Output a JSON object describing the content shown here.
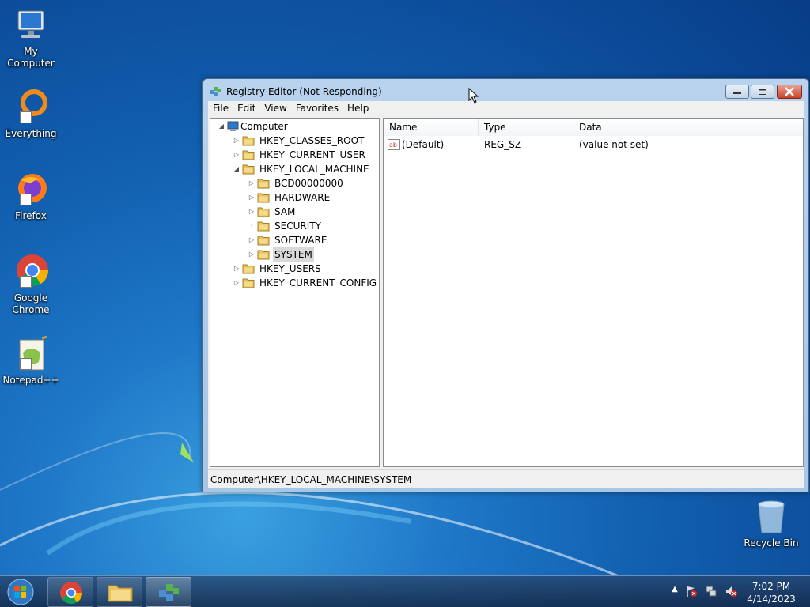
{
  "desktop": {
    "icons": [
      {
        "label": "My Computer"
      },
      {
        "label": "Everything"
      },
      {
        "label": "Firefox"
      },
      {
        "label": "Google Chrome"
      },
      {
        "label": "Notepad++"
      },
      {
        "label": "Recycle Bin"
      }
    ]
  },
  "window": {
    "title": "Registry Editor (Not Responding)",
    "menu": [
      "File",
      "Edit",
      "View",
      "Favorites",
      "Help"
    ],
    "tree": {
      "root": "Computer",
      "items": [
        {
          "label": "HKEY_CLASSES_ROOT",
          "expander": "collapsed"
        },
        {
          "label": "HKEY_CURRENT_USER",
          "expander": "collapsed"
        },
        {
          "label": "HKEY_LOCAL_MACHINE",
          "expander": "expanded"
        },
        {
          "label": "BCD00000000",
          "expander": "collapsed"
        },
        {
          "label": "HARDWARE",
          "expander": "collapsed"
        },
        {
          "label": "SAM",
          "expander": "collapsed"
        },
        {
          "label": "SECURITY",
          "expander": "none"
        },
        {
          "label": "SOFTWARE",
          "expander": "collapsed"
        },
        {
          "label": "SYSTEM",
          "expander": "collapsed",
          "selected": true
        },
        {
          "label": "HKEY_USERS",
          "expander": "collapsed"
        },
        {
          "label": "HKEY_CURRENT_CONFIG",
          "expander": "collapsed"
        }
      ]
    },
    "list": {
      "columns": [
        "Name",
        "Type",
        "Data"
      ],
      "rows": [
        {
          "name": "(Default)",
          "type": "REG_SZ",
          "data": "(value not set)"
        }
      ]
    },
    "status_path": "Computer\\HKEY_LOCAL_MACHINE\\SYSTEM"
  },
  "taskbar": {
    "time": "7:02 PM",
    "date": "4/14/2023"
  },
  "colors": {
    "selection": "#d9d9d9",
    "folder": "#e8c25a",
    "accent": "#1f78c8"
  }
}
